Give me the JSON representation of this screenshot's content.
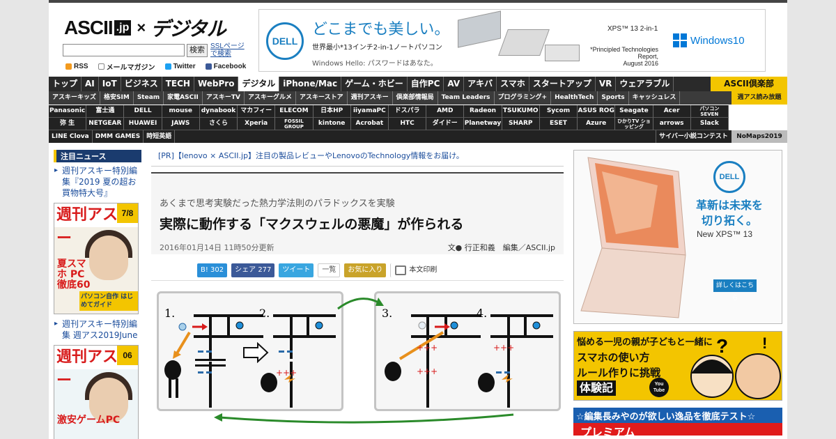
{
  "header": {
    "logo_ascii": "ASCII",
    "logo_jp": ".jp",
    "logo_x": "×",
    "logo_section": "デジタル",
    "search_btn": "検索",
    "ssl_line1": "SSLページ",
    "ssl_line2": "で検索",
    "rss": "RSS",
    "mail": "メールマガジン",
    "twitter": "Twitter",
    "facebook": "Facebook"
  },
  "banner": {
    "brand": "DELL",
    "headline": "どこまでも美しい。",
    "sub": "世界最小*13インチ2-in-1ノートパソコン",
    "sub2": "Windows Hello: パスワードはあなた。",
    "model": "XPS™ 13 2-in-1",
    "note_l1": "*Principled Technologies Report,",
    "note_l2": "August 2016",
    "windows": "Windows10"
  },
  "nav1": {
    "items": [
      "トップ",
      "AI",
      "IoT",
      "ビジネス",
      "TECH",
      "WebPro",
      "デジタル",
      "iPhone/Mac",
      "ゲーム・ホビー",
      "自作PC",
      "AV",
      "アキバ",
      "スマホ",
      "スタートアップ",
      "VR",
      "ウェアラブル"
    ],
    "club": "ASCII倶楽部"
  },
  "nav2": {
    "items": [
      "アスキーキッズ",
      "格安SIM",
      "Steam",
      "家電ASCII",
      "アスキーTV",
      "アスキーグルメ",
      "アスキーストア",
      "週刊アスキー",
      "倶楽部情報局",
      "Team Leaders",
      "プログラミング+",
      "HealthTech",
      "Sports",
      "キャッシュレス"
    ],
    "weekly": "週アス読み放題"
  },
  "grid": {
    "row1": [
      "Panasonic",
      "富士通",
      "DELL",
      "mouse",
      "dynabook",
      "マカフィー",
      "ELECOM",
      "日本HP",
      "iiyamaPC",
      "ドスパラ",
      "AMD",
      "Radeon",
      "TSUKUMO",
      "Sycom",
      "ASUS ROG",
      "Seagate",
      "Acer",
      "パソコン SEVEN"
    ],
    "row2": [
      "弥 生",
      "NETGEAR",
      "HUAWEI",
      "JAWS",
      "さくら",
      "Xperia",
      "FOSSIL GROUP",
      "kintone",
      "Acrobat",
      "HTC",
      "ダイドー",
      "Planetway",
      "SHARP",
      "ESET",
      "Azure",
      "ひかりTV ショッピング",
      "arrows",
      "Slack"
    ]
  },
  "nav6": {
    "items": [
      "LINE Clova",
      "DMM GAMES",
      "時短英語"
    ],
    "cyber": "サイバー小説コンテスト",
    "nomaps": "NoMaps2019"
  },
  "sidebar": {
    "head": "注目ニュース",
    "item1": "週刊アスキー特別編集『2019 夏の超お買物特大号』",
    "item2": "週刊アスキー特別編集 週アス2019June",
    "mag1_title": "週刊アスキー",
    "mag1_num": "7/8",
    "mag1_big": "夏スマホ PC 徹底60",
    "mag1_band": "パソコン自作 はじめてガイド",
    "mag2_title": "週刊アスキー",
    "mag2_num": "06",
    "mag2_big": "激安ゲームPC"
  },
  "article": {
    "pr": "[PR]【lenovo × ASCII.jp】注目の製品レビューやLenovoのTechnology情報をお届け。",
    "subtitle": "あくまで思考実験だった熱力学法則のパラドックスを実験",
    "title": "実際に動作する「マクスウェルの悪魔」が作られる",
    "date": "2016年01月14日 11時50分更新",
    "author": "文● 行正和義　編集／ASCII.jp",
    "hatena": "B! 302",
    "fb": "シェア 277",
    "tweet": "ツイート",
    "list": "一覧",
    "fav": "お気に入り",
    "print": "本文印刷",
    "fig_labels": [
      "1.",
      "2.",
      "3.",
      "4."
    ]
  },
  "right": {
    "dell": "DELL",
    "headline": "革新は未来を切り拓く。",
    "model": "New XPS™ 13",
    "detail": "詳しくはこちら",
    "ad2_t1": "悩める一児の親が子どもと一緒に",
    "ad2_t2a": "スマホの使い方",
    "ad2_t2b": "ルール作りに挑戦",
    "ad2_t3": "体験記",
    "ad2_yt": "You Tube",
    "ad3_text": "☆編集長みやのが欲しい逸品を徹底テスト☆",
    "ad3_red": "プレミアム"
  },
  "colors": {
    "nav_bg": "#2a2a2a",
    "accent_yellow": "#f3c500",
    "link_blue": "#1a4c9b",
    "dell_blue": "#1a7fc1"
  }
}
